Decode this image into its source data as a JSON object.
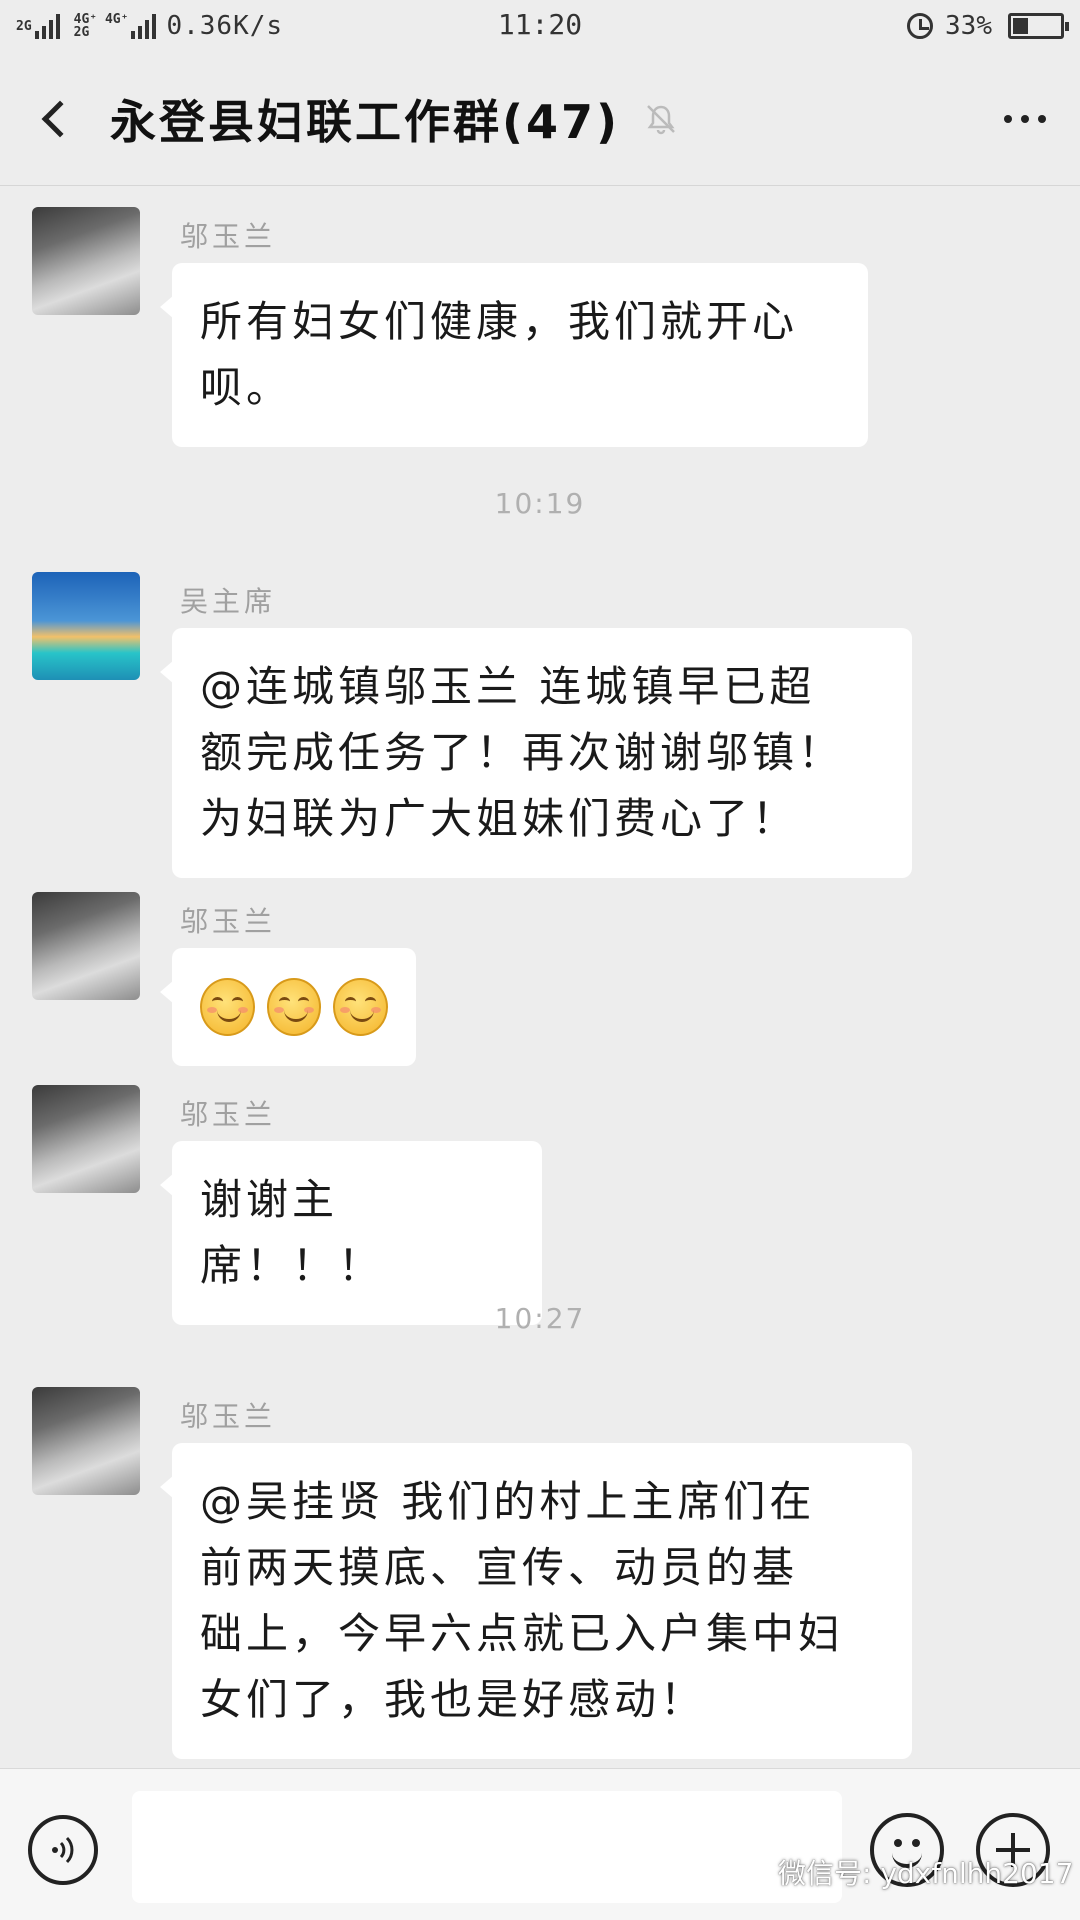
{
  "status_bar": {
    "sim1_tag": "2G",
    "sim2_tag_top": "4G⁺ 4G⁺",
    "sim2_tag_bottom": "2G",
    "net_speed": "0.36K/s",
    "time": "11:20",
    "battery_percent": "33%",
    "battery_level": 0.33
  },
  "header": {
    "back_icon": "back-arrow-icon",
    "title": "永登县妇联工作群(47)",
    "mute_icon": "muted-bell-icon",
    "more_icon": "more-dots-icon"
  },
  "messages": [
    {
      "type": "text",
      "sender": "邬玉兰",
      "avatar": "lotus-painting",
      "lines": [
        "所有妇女们健康，我们就开心",
        "呗。"
      ]
    },
    {
      "type": "time",
      "text": "10:19"
    },
    {
      "type": "text",
      "sender": "吴主席",
      "avatar": "beach-scene",
      "lines": [
        "@连城镇邬玉兰  连城镇早已超",
        "额完成任务了！再次谢谢邬镇！",
        "为妇联为广大姐妹们费心了！"
      ]
    },
    {
      "type": "emoji",
      "sender": "邬玉兰",
      "avatar": "lotus-painting",
      "emojis": [
        "smile",
        "smile",
        "smile"
      ]
    },
    {
      "type": "text",
      "sender": "邬玉兰",
      "avatar": "lotus-painting",
      "lines": [
        "谢谢主席！！！"
      ]
    },
    {
      "type": "time",
      "text": "10:27"
    },
    {
      "type": "text",
      "sender": "邬玉兰",
      "avatar": "lotus-painting",
      "lines": [
        "@吴挂贤  我们的村上主席们在",
        "前两天摸底、宣传、动员的基",
        "础上，今早六点就已入户集中妇",
        "女们了，我也是好感动！"
      ]
    }
  ],
  "input_bar": {
    "voice_icon": "voice-input-icon",
    "input_value": "",
    "emoji_icon": "emoji-face-icon",
    "plus_icon": "plus-circle-icon"
  },
  "watermark": {
    "icon": "wechat-logo-icon",
    "text": "微信号: ydxfnlhh2017"
  },
  "colors": {
    "background": "#ededed",
    "bubble": "#ffffff",
    "sender_name": "#a0a0a0",
    "timestamp": "#b0b0b0"
  }
}
